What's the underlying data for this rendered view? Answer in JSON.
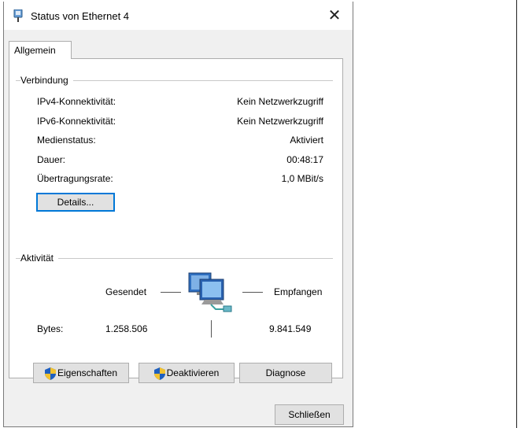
{
  "window": {
    "title": "Status von Ethernet 4",
    "close_glyph": "✕"
  },
  "tabs": [
    {
      "label": "Allgemein"
    }
  ],
  "connection": {
    "heading": "Verbindung",
    "rows": [
      {
        "label": "IPv4-Konnektivität:",
        "value": "Kein Netzwerkzugriff"
      },
      {
        "label": "IPv6-Konnektivität:",
        "value": "Kein Netzwerkzugriff"
      },
      {
        "label": "Medienstatus:",
        "value": "Aktiviert"
      },
      {
        "label": "Dauer:",
        "value": "00:48:17"
      },
      {
        "label": "Übertragungsrate:",
        "value": "1,0 MBit/s"
      }
    ],
    "details_label": "Details..."
  },
  "activity": {
    "heading": "Aktivität",
    "sent_label": "Gesendet",
    "received_label": "Empfangen",
    "bytes_label": "Bytes:",
    "bytes_sent": "1.258.506",
    "bytes_received": "9.841.549"
  },
  "actions": {
    "properties_label": "Eigenschaften",
    "disable_label": "Deaktivieren",
    "diagnose_label": "Diagnose"
  },
  "footer": {
    "close_label": "Schließen"
  },
  "colors": {
    "focus": "#0078d7",
    "shield_blue": "#1e5fbf",
    "shield_yellow": "#f2c230"
  }
}
